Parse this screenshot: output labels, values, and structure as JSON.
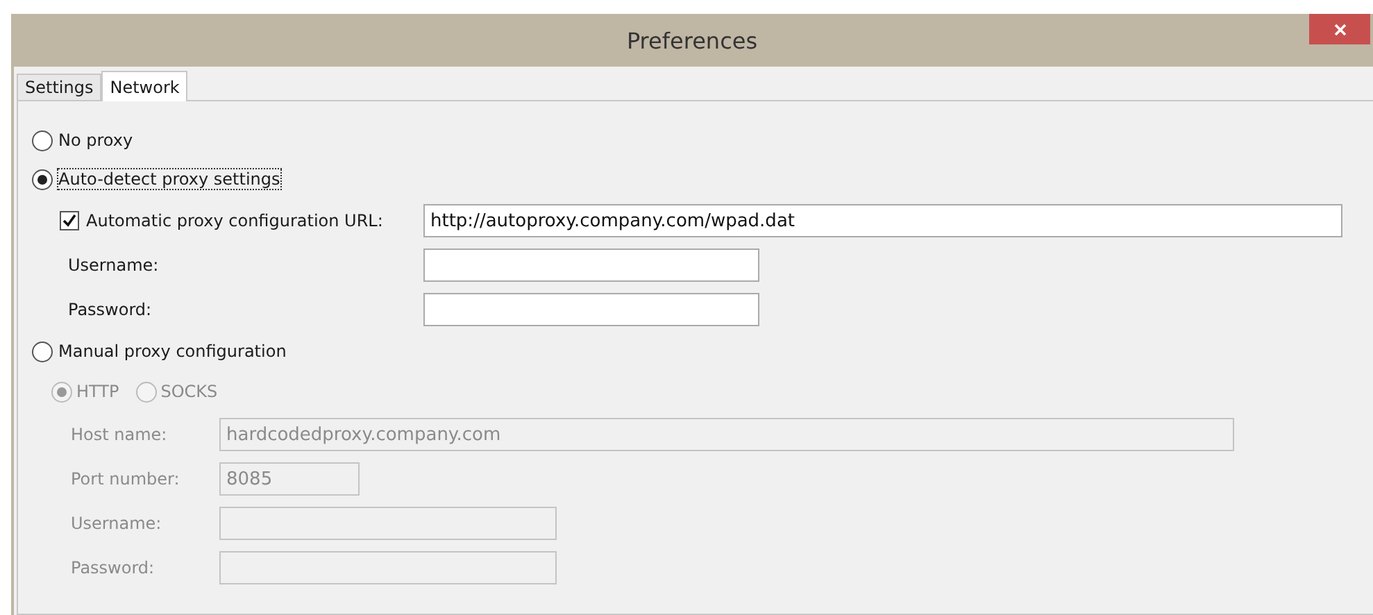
{
  "window": {
    "title": "Preferences"
  },
  "tabs": [
    {
      "label": "Settings",
      "selected": false
    },
    {
      "label": "Network",
      "selected": true
    }
  ],
  "proxy_modes": [
    {
      "label": "No proxy",
      "selected": false
    },
    {
      "label": "Auto-detect proxy settings",
      "selected": true,
      "focused": true,
      "fields": [
        {
          "kind": "checkbox",
          "label": "Automatic proxy configuration URL:",
          "checked": true,
          "value": "http://autoproxy.company.com/wpad.dat"
        },
        {
          "kind": "text",
          "label": "Username:"
        },
        {
          "kind": "text",
          "label": "Password:"
        }
      ]
    },
    {
      "label": "Manual proxy configuration",
      "selected": false,
      "disabled": true,
      "protocols": [
        {
          "label": "HTTP",
          "selected": true
        },
        {
          "label": "SOCKS",
          "selected": false
        }
      ],
      "fields": [
        {
          "kind": "text",
          "label": "Host name:",
          "value": "hardcodedproxy.company.com"
        },
        {
          "kind": "text",
          "label": "Port number:",
          "value": "8085"
        },
        {
          "kind": "text",
          "label": "Username:"
        },
        {
          "kind": "text",
          "label": "Password:"
        }
      ]
    }
  ]
}
